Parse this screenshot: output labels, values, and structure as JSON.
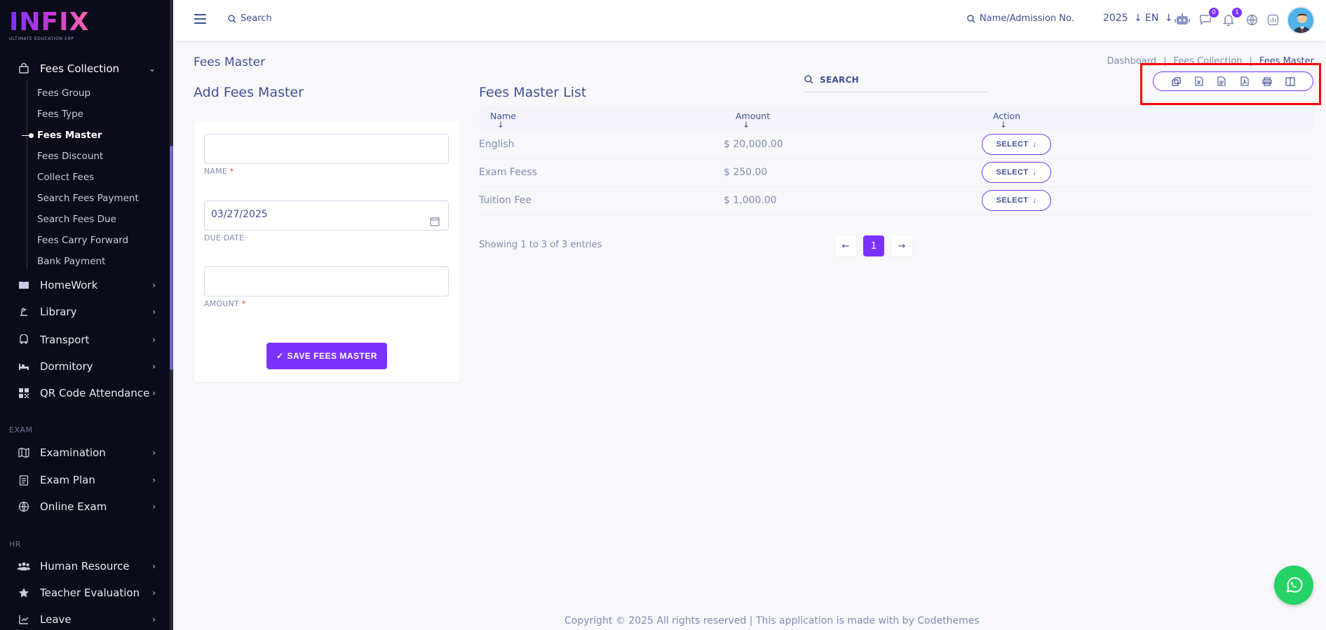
{
  "brand": {
    "logo_text": "INFIX",
    "logo_subtitle": "ULTIMATE EDUCATION ERP"
  },
  "sidebar": {
    "fees_collection": {
      "label": "Fees Collection",
      "icon": "bag-icon"
    },
    "sub_items": [
      {
        "label": "Fees Group"
      },
      {
        "label": "Fees Type"
      },
      {
        "label": "Fees Master",
        "active": true
      },
      {
        "label": "Fees Discount"
      },
      {
        "label": "Collect Fees"
      },
      {
        "label": "Search Fees Payment"
      },
      {
        "label": "Search Fees Due"
      },
      {
        "label": "Fees Carry Forward"
      },
      {
        "label": "Bank Payment"
      }
    ],
    "items": [
      {
        "label": "HomeWork",
        "icon": "book-icon"
      },
      {
        "label": "Library",
        "icon": "library-icon"
      },
      {
        "label": "Transport",
        "icon": "bus-icon"
      },
      {
        "label": "Dormitory",
        "icon": "bed-icon"
      },
      {
        "label": "QR Code Attendance",
        "icon": "qr-icon"
      }
    ],
    "exam_section": "EXAM",
    "exam_items": [
      {
        "label": "Examination",
        "icon": "map-icon"
      },
      {
        "label": "Exam Plan",
        "icon": "clipboard-icon"
      },
      {
        "label": "Online Exam",
        "icon": "globe-icon"
      }
    ],
    "hr_section": "HR",
    "hr_items": [
      {
        "label": "Human Resource",
        "icon": "users-icon"
      },
      {
        "label": "Teacher Evaluation",
        "icon": "star-icon"
      },
      {
        "label": "Leave",
        "icon": "leave-icon"
      }
    ]
  },
  "header": {
    "search_placeholder": "Search",
    "admission_search": "Name/Admission No.",
    "year": "2025",
    "language": "EN",
    "messages_count": "0",
    "notifications_count": "1"
  },
  "page": {
    "title": "Fees Master",
    "breadcrumb": [
      "Dashboard",
      "Fees Collection",
      "Fees Master"
    ]
  },
  "form": {
    "title": "Add Fees Master",
    "name_label": "NAME",
    "name_value": "",
    "due_date_label": "DUE DATE",
    "due_date_value": "03/27/2025",
    "amount_label": "AMOUNT",
    "amount_value": "",
    "required_mark": "*",
    "save_label": "SAVE FEES MASTER"
  },
  "list": {
    "title": "Fees Master List",
    "search_label": "SEARCH",
    "export_buttons": [
      "copy-icon",
      "excel-icon",
      "csv-icon",
      "pdf-icon",
      "print-icon",
      "columns-icon"
    ],
    "columns": [
      "Name",
      "Amount",
      "Action"
    ],
    "rows": [
      {
        "name": "English",
        "amount": "$ 20,000.00",
        "action": "SELECT"
      },
      {
        "name": "Exam Feess",
        "amount": "$ 250.00",
        "action": "SELECT"
      },
      {
        "name": "Tuition Fee",
        "amount": "$ 1,000.00",
        "action": "SELECT"
      }
    ],
    "entries_text": "Showing 1 to 3 of 3 entries",
    "current_page": "1"
  },
  "footer": {
    "text": "Copyright © 2025 All rights reserved | This application is made with by Codethemes"
  },
  "colors": {
    "primary": "#7c32ff",
    "text": "#415094",
    "muted": "#828bb2",
    "sidebar_bg": "#0b0b19",
    "highlight": "#ff0000",
    "whatsapp": "#25d366"
  }
}
